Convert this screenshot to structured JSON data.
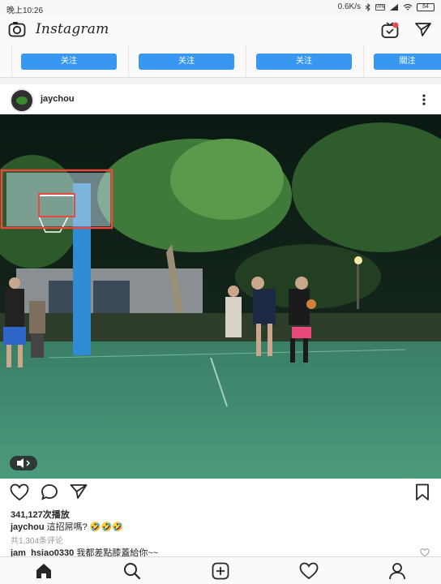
{
  "status_bar": {
    "time": "晚上10:26",
    "net_speed": "0.6K/s",
    "battery": "64",
    "signal_label": "VPN"
  },
  "header": {
    "logo": "Instagram",
    "icons": [
      "camera-icon",
      "igtv-icon",
      "direct-send-icon"
    ]
  },
  "suggestions": {
    "buttons": [
      "关注",
      "关注",
      "关注",
      "關注"
    ]
  },
  "post": {
    "username": "jaychou",
    "views": "341,127次播放",
    "caption_user": "jaychou",
    "caption_text": "這招屌嗎? 🤣🤣🤣",
    "comments_link": "共1,304条评论",
    "comment_user": "jam_hsiao0330",
    "comment_text": "我都差點膝蓋給你~~"
  },
  "bottom_nav": {
    "items": [
      "home-icon",
      "search-icon",
      "new-post-icon",
      "activity-heart-icon",
      "profile-icon"
    ]
  },
  "colors": {
    "follow_button": "#3897f0",
    "court_green": "#3e8a6e",
    "pole_blue": "#2e8bd4",
    "highlight_box": "#e8493f"
  }
}
